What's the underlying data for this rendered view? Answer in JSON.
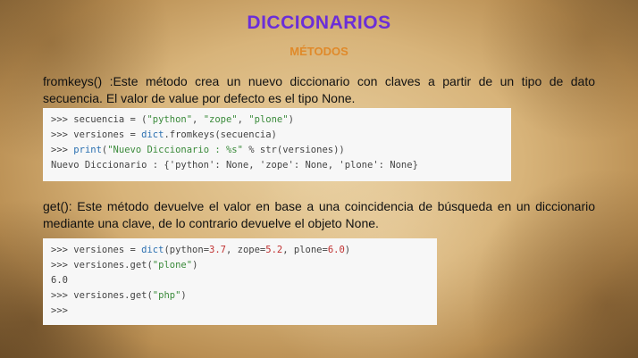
{
  "title": "DICCIONARIOS",
  "subtitle": "MÉTODOS",
  "para1": "fromkeys() :Este método crea un nuevo diccionario con claves a partir de un tipo de dato secuencia. El valor de value por defecto es el tipo None.",
  "code1": {
    "l1_a": ">>> secuencia = (",
    "l1_s1": "\"python\"",
    "l1_c1": ", ",
    "l1_s2": "\"zope\"",
    "l1_c2": ", ",
    "l1_s3": "\"plone\"",
    "l1_e": ")",
    "l2_a": ">>> versiones = ",
    "l2_k": "dict",
    "l2_b": ".fromkeys(secuencia)",
    "l3_a": ">>> ",
    "l3_k": "print",
    "l3_b": "(",
    "l3_s": "\"Nuevo Diccionario : %s\"",
    "l3_c": " % str(versiones))",
    "l4": "Nuevo Diccionario : {'python': None, 'zope': None, 'plone': None}"
  },
  "para2": "get(): Este método devuelve el valor en base a una coincidencia de búsqueda en un diccionario mediante una clave, de lo contrario devuelve el objeto None.",
  "code2": {
    "l1_a": ">>> versiones = ",
    "l1_k": "dict",
    "l1_b": "(python=",
    "l1_n1": "3.7",
    "l1_c": ", zope=",
    "l1_n2": "5.2",
    "l1_d": ", plone=",
    "l1_n3": "6.0",
    "l1_e": ")",
    "l2_a": ">>> versiones.get(",
    "l2_s": "\"plone\"",
    "l2_e": ")",
    "l3": "6.0",
    "l4_a": ">>> versiones.get(",
    "l4_s": "\"php\"",
    "l4_e": ")",
    "l5": ">>>"
  }
}
